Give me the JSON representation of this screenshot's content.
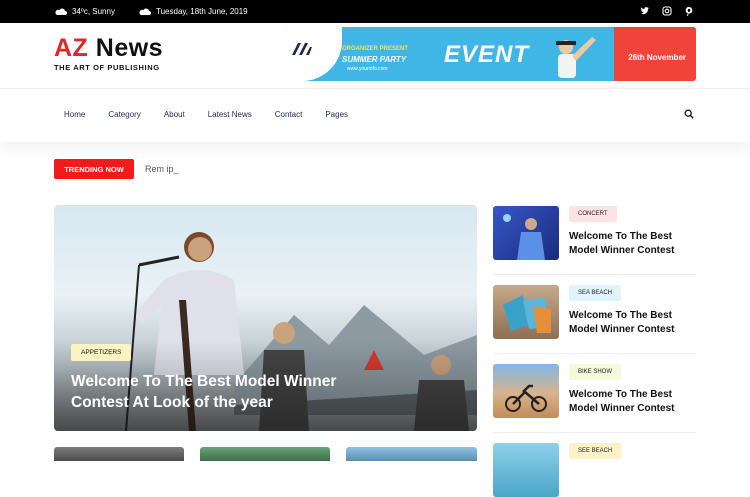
{
  "topbar": {
    "weather": "34ºc, Sunny",
    "date": "Tuesday, 18th June, 2019"
  },
  "social": [
    "twitter-icon",
    "instagram-icon",
    "pinterest-icon"
  ],
  "logo": {
    "part1": "AZ",
    "part2": "News",
    "tagline": "THE ART OF PUBLISHING"
  },
  "banner": {
    "organizer": "ORGANIZER PRESENT",
    "party": "SUMMER PARTY",
    "url": "www.yourinfo.com",
    "event": "EVENT",
    "date": "26th November"
  },
  "nav": [
    "Home",
    "Category",
    "About",
    "Latest News",
    "Contact",
    "Pages"
  ],
  "trending": {
    "button": "TRENDING NOW",
    "text": "Rem ip_"
  },
  "hero": {
    "tag": "APPETIZERS",
    "title": "Welcome To The Best Model Winner Contest At Look of the year"
  },
  "side": [
    {
      "tag": "CONCERT",
      "title": "Welcome To The Best Model Winner Contest",
      "tag_color": "#fde3e3"
    },
    {
      "tag": "SEA BEACH",
      "title": "Welcome To The Best Model Winner Contest",
      "tag_color": "#dff4fb"
    },
    {
      "tag": "BIKE SHOW",
      "title": "Welcome To The Best Model Winner Contest",
      "tag_color": "#f3f9d9"
    },
    {
      "tag": "SEE BEACH",
      "title": "",
      "tag_color": "#fdf1c8"
    }
  ],
  "colors": {
    "accent": "#e0262b",
    "trend": "#f51a1a",
    "topbar": "#000000"
  }
}
